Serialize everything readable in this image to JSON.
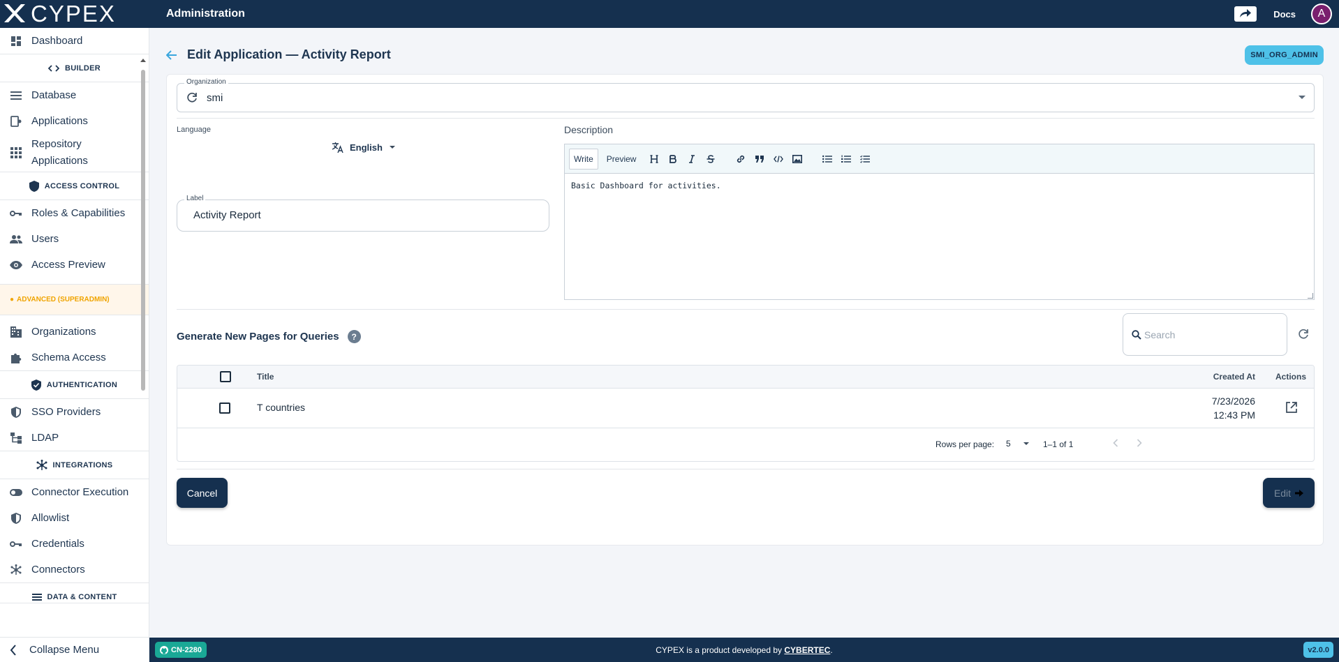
{
  "app": {
    "brand": "CYPEX",
    "title": "Administration"
  },
  "topbar": {
    "docs": "Docs",
    "avatar_initial": "A"
  },
  "sidebar": {
    "dashboard": "Dashboard",
    "section_builder": "BUILDER",
    "database": "Database",
    "applications": "Applications",
    "repository_applications": "Repository Applications",
    "section_access_control": "ACCESS CONTROL",
    "roles": "Roles & Capabilities",
    "users": "Users",
    "access_preview": "Access Preview",
    "section_advanced": "ADVANCED (SUPERADMIN)",
    "organizations": "Organizations",
    "schema_access": "Schema Access",
    "section_authentication": "AUTHENTICATION",
    "sso_providers": "SSO Providers",
    "ldap": "LDAP",
    "section_integrations": "INTEGRATIONS",
    "connector_execution": "Connector Execution",
    "allowlist": "Allowlist",
    "credentials": "Credentials",
    "connectors": "Connectors",
    "section_data_content": "DATA & CONTENT",
    "collapse": "Collapse Menu"
  },
  "page": {
    "title": "Edit Application — Activity Report",
    "role_chip": "SMI_ORG_ADMIN"
  },
  "form": {
    "organization_label": "Organization",
    "organization_value": "smi",
    "language_label": "Language",
    "language_value": "English",
    "label_label": "Label",
    "label_value": "Activity Report",
    "description_label": "Description",
    "editor_tabs": {
      "write": "Write",
      "preview": "Preview"
    },
    "description_value": "Basic Dashboard for activities."
  },
  "queries": {
    "title": "Generate New Pages for Queries",
    "search_placeholder": "Search",
    "columns": {
      "title": "Title",
      "created_at": "Created At",
      "actions": "Actions"
    },
    "rows": [
      {
        "title": "T countries",
        "created_date": "7/23/2026",
        "created_time": "12:43 PM"
      }
    ],
    "rows_per_page_label": "Rows per page:",
    "rows_per_page": "5",
    "range": "1–1 of 1"
  },
  "actions": {
    "cancel": "Cancel",
    "edit": "Edit"
  },
  "footer": {
    "badge": "CN-2280",
    "text_prefix": "CYPEX is a product developed by ",
    "company": "CYBERTEC",
    "text_suffix": ".",
    "version": "v2.0.0"
  },
  "colors": {
    "navy": "#15304f",
    "accent": "#4ec1e8",
    "warning": "#f0a400",
    "teal": "#1aa896"
  }
}
